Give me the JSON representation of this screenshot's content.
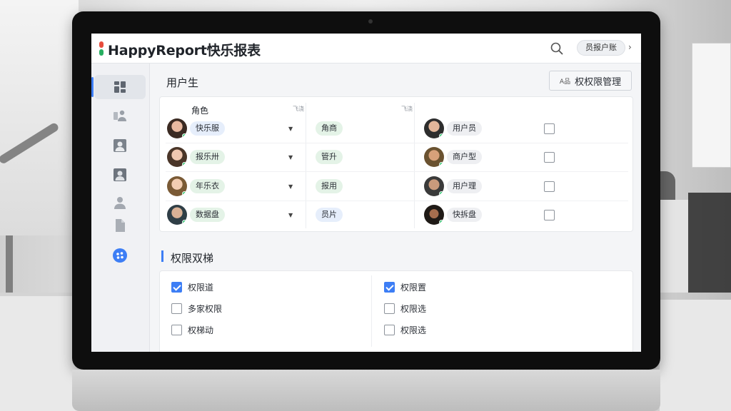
{
  "header": {
    "app_title": "HappyReport快乐报表",
    "user_label": "员报户账",
    "search_icon": "search-icon"
  },
  "sidebar": {
    "items": [
      {
        "icon": "dashboard-icon",
        "active": true
      },
      {
        "icon": "users-icon",
        "active": false
      },
      {
        "icon": "user-portrait-icon",
        "active": false
      },
      {
        "icon": "user-card-icon",
        "active": false
      },
      {
        "icon": "person-icon",
        "active": false
      },
      {
        "icon": "document-icon",
        "active": false
      },
      {
        "icon": "settings-gear-icon",
        "active": false
      }
    ],
    "accent": "#3d7ef5"
  },
  "main": {
    "page_title": "用户生",
    "manage_button": {
      "icon_text": "A品",
      "label": "权权限管理"
    },
    "users_table": {
      "column_header": "角色",
      "sort_marks": [
        "飞浇",
        "飞浇"
      ],
      "rows": [
        {
          "left_name": "快乐服",
          "role": "角商",
          "right_name": "用户员"
        },
        {
          "left_name": "报乐卅",
          "role": "管升",
          "right_name": "商户型"
        },
        {
          "left_name": "年乐衣",
          "role": "报用",
          "right_name": "用户理"
        },
        {
          "left_name": "数据盘",
          "role": "员片",
          "right_name": "快拆盘"
        }
      ]
    },
    "permissions": {
      "title": "权限双梯",
      "left": [
        {
          "label": "权限道",
          "checked": true
        },
        {
          "label": "多家权限",
          "checked": false
        },
        {
          "label": "权梯动",
          "checked": false
        }
      ],
      "right": [
        {
          "label": "权限置",
          "checked": true
        },
        {
          "label": "权限选",
          "checked": false
        },
        {
          "label": "权限选",
          "checked": false
        }
      ]
    }
  }
}
